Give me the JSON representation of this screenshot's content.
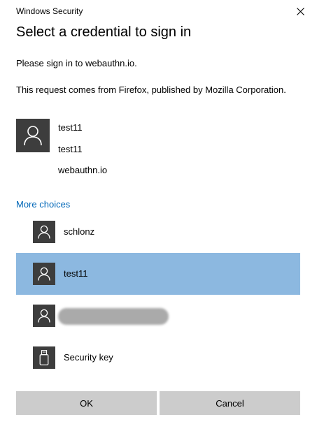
{
  "window": {
    "title": "Windows Security"
  },
  "heading": "Select a credential to sign in",
  "messages": {
    "sign_in": "Please sign in to webauthn.io.",
    "request_origin": "This request comes from Firefox, published by Mozilla Corporation."
  },
  "selected_credential": {
    "icon": "user-icon",
    "username": "test11",
    "display_name": "test11",
    "relying_party": "webauthn.io"
  },
  "more_choices": {
    "link_label": "More choices",
    "items": [
      {
        "icon": "user-icon",
        "label": "schlonz",
        "selected": false
      },
      {
        "icon": "user-icon",
        "label": "test11",
        "selected": true
      },
      {
        "icon": "user-icon",
        "label": "",
        "redacted": true,
        "selected": false
      },
      {
        "icon": "usb-key-icon",
        "label": "Security key",
        "selected": false
      }
    ]
  },
  "buttons": {
    "ok_label": "OK",
    "cancel_label": "Cancel"
  },
  "colors": {
    "link": "#0067b8",
    "selection": "#8cb8e0",
    "icon_tile": "#3d3d3d",
    "button": "#cccccc"
  }
}
